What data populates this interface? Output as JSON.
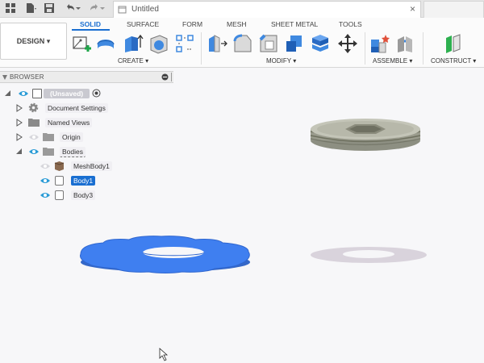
{
  "window": {
    "doc_tab_title": "Untitled"
  },
  "toolbar": {
    "workspace_button": "DESIGN ▾",
    "tabs": [
      "SOLID",
      "SURFACE",
      "FORM",
      "MESH",
      "SHEET METAL",
      "TOOLS"
    ],
    "active_tab": "SOLID",
    "groups": [
      "CREATE ▾",
      "MODIFY ▾",
      "ASSEMBLE ▾",
      "CONSTRUCT ▾"
    ]
  },
  "browser": {
    "title": "BROWSER",
    "items": [
      {
        "label": "(Unsaved)",
        "icon": "component-icon"
      },
      {
        "label": "Document Settings",
        "icon": "gear-icon"
      },
      {
        "label": "Named Views",
        "icon": "folder-icon"
      },
      {
        "label": "Origin",
        "icon": "folder-icon"
      },
      {
        "label": "Bodies",
        "icon": "folder-icon"
      },
      {
        "label": "MeshBody1",
        "icon": "mesh-body-icon"
      },
      {
        "label": "Body1",
        "icon": "body-icon"
      },
      {
        "label": "Body3",
        "icon": "body-icon"
      }
    ]
  },
  "colors": {
    "accent": "#1a6fd1",
    "gear_blue": "#3f7ff0"
  }
}
